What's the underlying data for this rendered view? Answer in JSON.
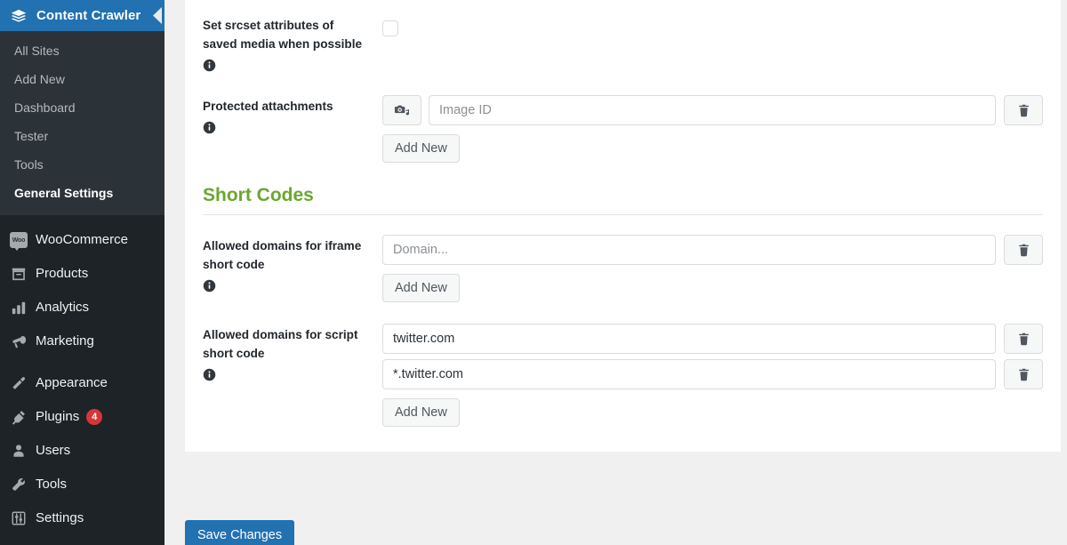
{
  "sidebar": {
    "plugin": {
      "title": "Content Crawler",
      "icon": "stacked-papers-icon",
      "collapse_icon": "chevron-left-icon"
    },
    "submenu": [
      {
        "label": "All Sites",
        "current": false
      },
      {
        "label": "Add New",
        "current": false
      },
      {
        "label": "Dashboard",
        "current": false
      },
      {
        "label": "Tester",
        "current": false
      },
      {
        "label": "Tools",
        "current": false
      },
      {
        "label": "General Settings",
        "current": true
      }
    ],
    "menu_groups": [
      [
        {
          "label": "WooCommerce",
          "icon": "woo-icon",
          "badge": null
        },
        {
          "label": "Products",
          "icon": "products-icon",
          "badge": null
        },
        {
          "label": "Analytics",
          "icon": "analytics-icon",
          "badge": null
        },
        {
          "label": "Marketing",
          "icon": "megaphone-icon",
          "badge": null
        }
      ],
      [
        {
          "label": "Appearance",
          "icon": "paintbrush-icon",
          "badge": null
        },
        {
          "label": "Plugins",
          "icon": "plug-icon",
          "badge": "4"
        },
        {
          "label": "Users",
          "icon": "user-icon",
          "badge": null
        },
        {
          "label": "Tools",
          "icon": "wrench-icon",
          "badge": null
        },
        {
          "label": "Settings",
          "icon": "sliders-icon",
          "badge": null
        }
      ]
    ]
  },
  "main": {
    "srcset": {
      "label": "Set srcset attributes of saved media when possible",
      "checked": false,
      "info_icon": "info-icon"
    },
    "protected_attachments": {
      "label": "Protected attachments",
      "info_icon": "info-icon",
      "media_icon": "media-library-icon",
      "delete_icon": "trash-icon",
      "placeholder": "Image ID",
      "value": "",
      "add_label": "Add New"
    },
    "short_codes": {
      "heading": "Short Codes",
      "iframe": {
        "label": "Allowed domains for iframe short code",
        "info_icon": "info-icon",
        "placeholder": "Domain...",
        "rows": [
          {
            "value": "",
            "delete_icon": "trash-icon"
          }
        ],
        "add_label": "Add New"
      },
      "script": {
        "label": "Allowed domains for script short code",
        "info_icon": "info-icon",
        "placeholder": "Domain...",
        "rows": [
          {
            "value": "twitter.com",
            "delete_icon": "trash-icon"
          },
          {
            "value": "*.twitter.com",
            "delete_icon": "trash-icon"
          }
        ],
        "add_label": "Add New"
      }
    },
    "save_label": "Save Changes"
  },
  "colors": {
    "admin_blue": "#2271b1",
    "sidebar_bg": "#1d2327",
    "submenu_bg": "#2c3338",
    "section_green": "#6aa731",
    "badge_red": "#d63638"
  }
}
